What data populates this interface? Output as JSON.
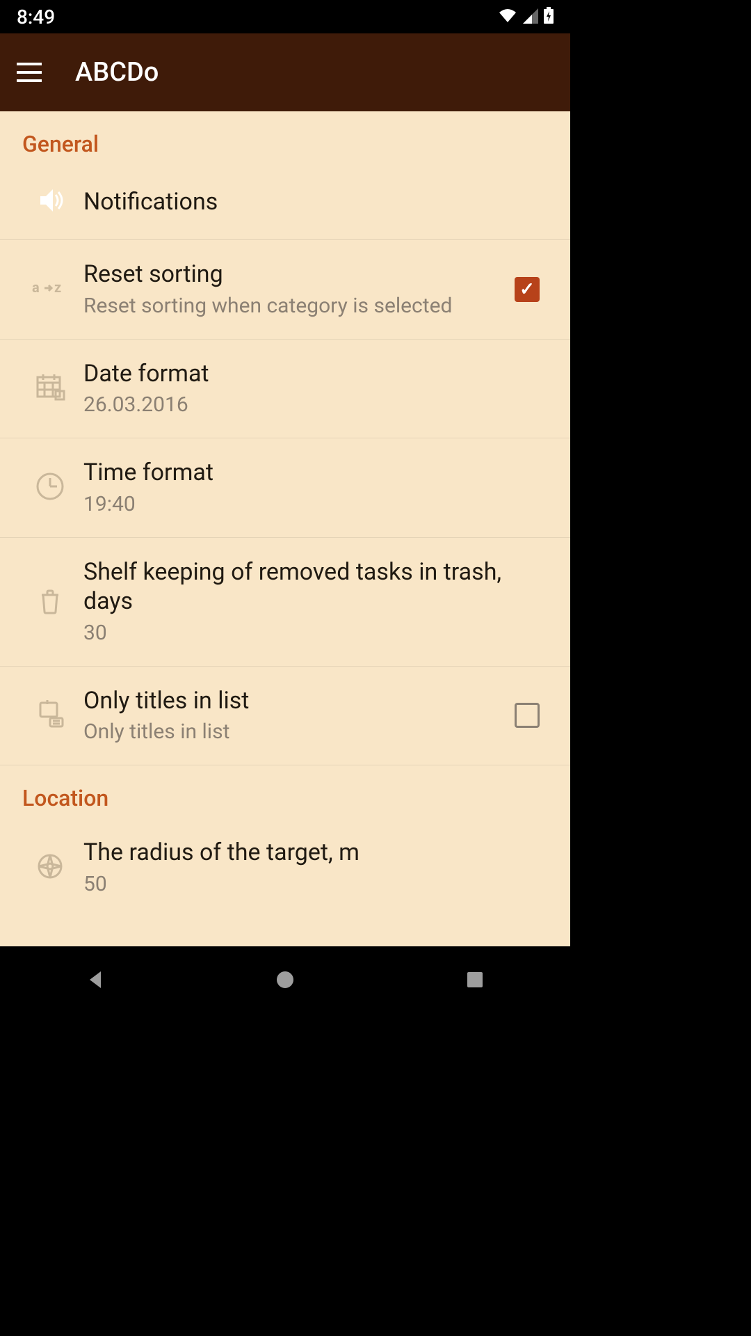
{
  "status": {
    "time": "8:49"
  },
  "header": {
    "title": "ABCDo"
  },
  "sections": {
    "general": {
      "label": "General",
      "notifications": {
        "title": "Notifications"
      },
      "reset_sorting": {
        "title": "Reset sorting",
        "subtitle": "Reset sorting when category is selected",
        "checked": true
      },
      "date_format": {
        "title": "Date format",
        "value": "26.03.2016"
      },
      "time_format": {
        "title": "Time format",
        "value": "19:40"
      },
      "shelf_keeping": {
        "title": "Shelf keeping of removed tasks in trash, days",
        "value": "30"
      },
      "only_titles": {
        "title": "Only titles in list",
        "subtitle": "Only titles in list",
        "checked": false
      }
    },
    "location": {
      "label": "Location",
      "radius": {
        "title": "The radius of the target, m",
        "value": "50"
      }
    }
  },
  "colors": {
    "accent": "#c2571e",
    "appbar": "#3f1b09",
    "surface": "#f9e6c7",
    "check": "#b7421a"
  }
}
